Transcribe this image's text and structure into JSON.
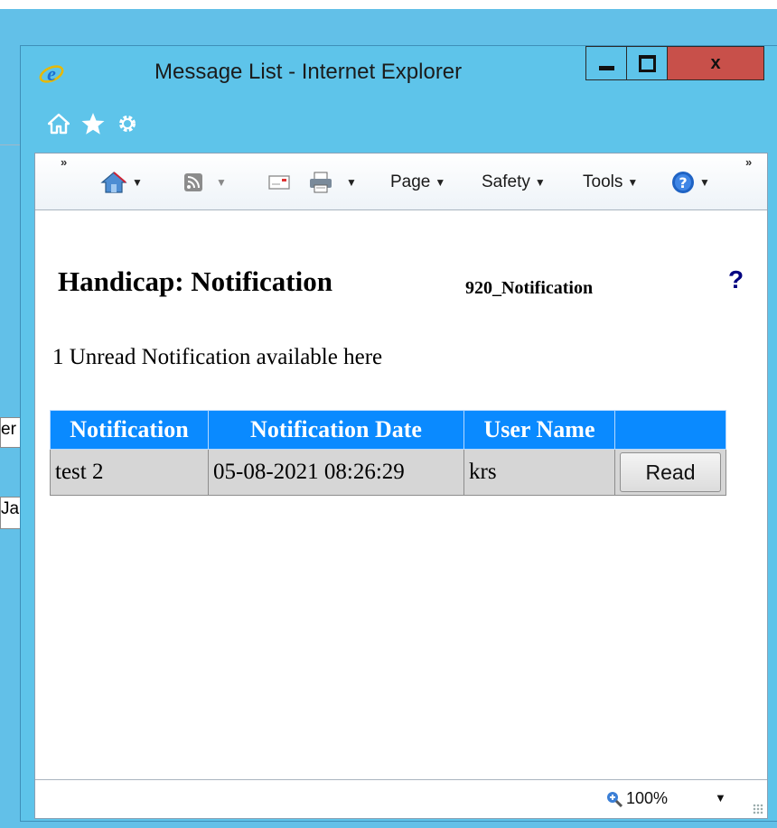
{
  "background": {
    "fragment_1": "er",
    "fragment_2": "Ja"
  },
  "window": {
    "title": "Message List - Internet Explorer",
    "close_label": "x"
  },
  "toolbar": {
    "page_label": "Page",
    "safety_label": "Safety",
    "tools_label": "Tools",
    "chevron": "»"
  },
  "page": {
    "title": "Handicap: Notification",
    "form_id": "920_Notification",
    "help": "?",
    "summary": "1 Unread Notification available here"
  },
  "table": {
    "headers": [
      "Notification",
      "Notification Date",
      "User Name",
      ""
    ],
    "rows": [
      {
        "notification": "test 2",
        "date": "05-08-2021 08:26:29",
        "user": "krs",
        "action": "Read"
      }
    ]
  },
  "status": {
    "zoom": "100%"
  },
  "colors": {
    "header_blue": "#0a8aff",
    "window_frame": "#5ec4ea",
    "close_red": "#c8504a",
    "help_navy": "#000080"
  }
}
